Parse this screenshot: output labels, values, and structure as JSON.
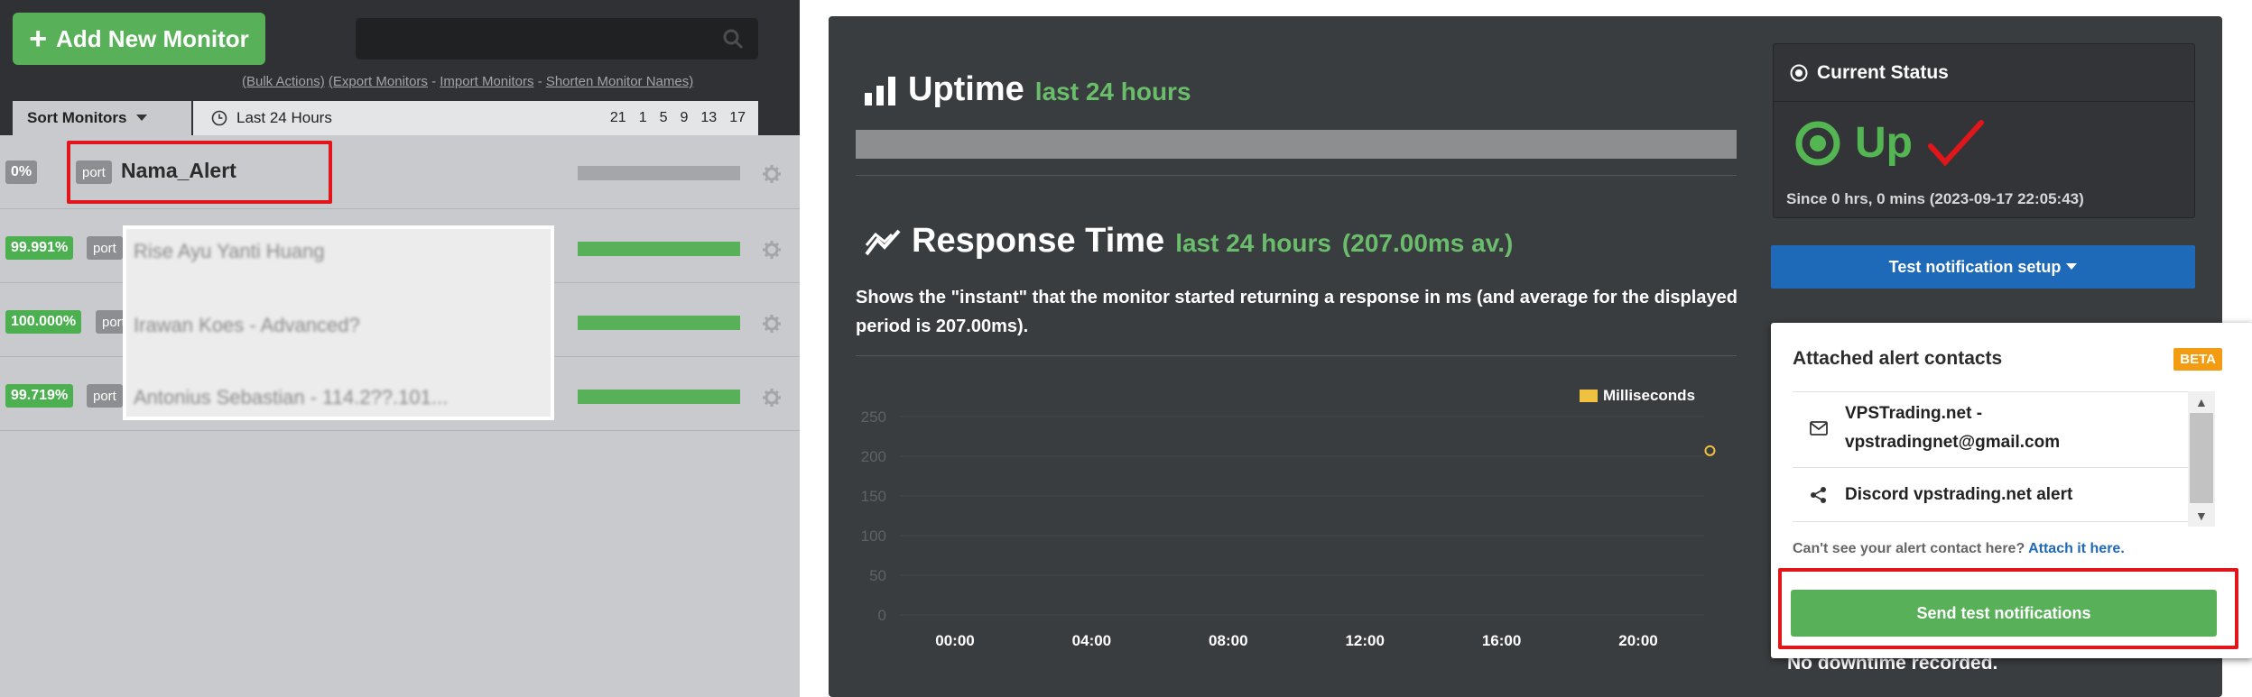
{
  "left_panel": {
    "add_button": "Add New Monitor",
    "bulk_actions": "(Bulk Actions)",
    "export_monitors": "(Export Monitors",
    "import_monitors": "Import Monitors",
    "shorten_names": "Shorten Monitor Names)",
    "sep1": " - ",
    "sep2": " - ",
    "sort_label": "Sort Monitors",
    "period_label": "Last 24 Hours",
    "period_options": [
      "21",
      "1",
      "5",
      "9",
      "13",
      "17"
    ],
    "monitors": [
      {
        "uptime": "0%",
        "type": "port",
        "name": "Nama_Alert",
        "uptime_color": "#8d8e91",
        "bar_color": "#a5a6a9"
      },
      {
        "uptime": "99.991%",
        "type": "port",
        "name": "Rise Ayu Yanti Huang",
        "uptime_color": "#4caf50",
        "bar_color": "#58b158"
      },
      {
        "uptime": "100.000%",
        "type": "port",
        "name": "Irawan Koes - Advanced?",
        "uptime_color": "#4caf50",
        "bar_color": "#58b158"
      },
      {
        "uptime": "99.719%",
        "type": "port",
        "name": "Antonius Sebastian - 114.2??.101...",
        "uptime_color": "#4caf50",
        "bar_color": "#58b158"
      }
    ]
  },
  "uptime": {
    "title": "Uptime",
    "period": "last 24 hours"
  },
  "response_time": {
    "title": "Response Time",
    "period": "last 24 hours",
    "average": "(207.00ms av.)",
    "description": "Shows the \"instant\" that the monitor started returning a response in ms (and average for the displayed period is 207.00ms)."
  },
  "chart_data": {
    "type": "line",
    "title": "",
    "xlabel": "",
    "ylabel": "",
    "ylim": [
      0,
      250
    ],
    "y_ticks": [
      "250",
      "200",
      "150",
      "100",
      "50",
      "0"
    ],
    "x_ticks": [
      "00:00",
      "04:00",
      "08:00",
      "12:00",
      "16:00",
      "20:00"
    ],
    "series": [
      {
        "name": "Milliseconds",
        "color": "#f0c040",
        "x": [
          "22:06"
        ],
        "values": [
          207
        ]
      }
    ],
    "legend_position": "top-right",
    "grid": true
  },
  "status": {
    "title": "Current Status",
    "value": "Up",
    "since": "Since 0 hrs, 0 mins (2023-09-17 22:05:43)"
  },
  "test_button": "Test notification setup",
  "below_text": "No downtime recorded.",
  "popup": {
    "title": "Attached alert contacts",
    "badge": "BETA",
    "contacts": [
      {
        "line1": "VPSTrading.net -",
        "line2": "vpstradingnet@gmail.com",
        "icon": "envelope-icon"
      },
      {
        "line1": "Discord vpstrading.net alert",
        "icon": "share-icon"
      }
    ],
    "cant_see": "Can't see your alert contact here?",
    "attach_link": "Attach it here.",
    "send_button": "Send test notifications"
  },
  "colors": {
    "green": "#58b158",
    "blue": "#1e6ab8",
    "red_highlight": "#e0161a",
    "chart_marker": "#f0c040"
  }
}
